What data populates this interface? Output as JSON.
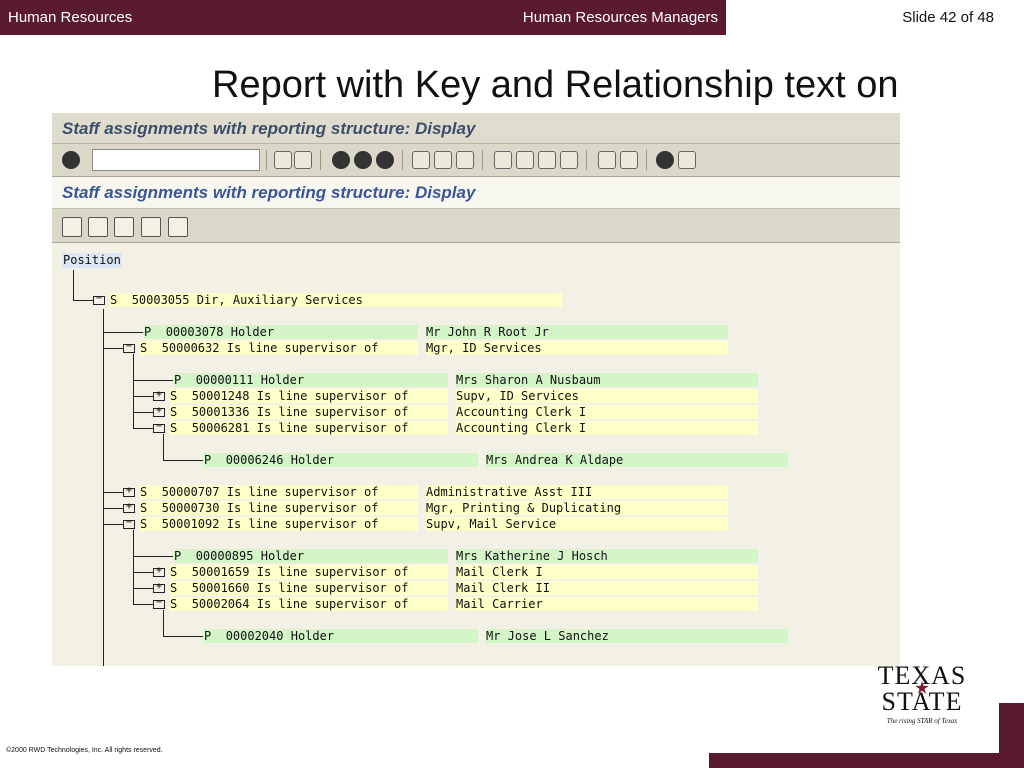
{
  "header": {
    "left": "Human Resources",
    "center": "Human Resources Managers",
    "slide": "Slide 42 of 48"
  },
  "slide_title": "Report with Key and Relationship text on",
  "sap": {
    "window_title": "Staff assignments with reporting structure: Display",
    "screen_title": "Staff assignments with reporting structure: Display",
    "command_value": "",
    "root_label": "Position"
  },
  "tree_rows": [
    {
      "type": "S",
      "id": "50003055",
      "rel": "Dir, Auxiliary Services",
      "target": ""
    },
    {
      "type": "P",
      "id": "00003078",
      "rel": "Holder",
      "target": "Mr John R Root Jr"
    },
    {
      "type": "S",
      "id": "50000632",
      "rel": "Is line supervisor of",
      "target": "Mgr, ID Services"
    },
    {
      "type": "P",
      "id": "00000111",
      "rel": "Holder",
      "target": "Mrs Sharon A Nusbaum"
    },
    {
      "type": "S",
      "id": "50001248",
      "rel": "Is line supervisor of",
      "target": "Supv, ID Services"
    },
    {
      "type": "S",
      "id": "50001336",
      "rel": "Is line supervisor of",
      "target": "Accounting Clerk I"
    },
    {
      "type": "S",
      "id": "50006281",
      "rel": "Is line supervisor of",
      "target": "Accounting Clerk I"
    },
    {
      "type": "P",
      "id": "00006246",
      "rel": "Holder",
      "target": "Mrs Andrea K Aldape"
    },
    {
      "type": "S",
      "id": "50000707",
      "rel": "Is line supervisor of",
      "target": "Administrative Asst III"
    },
    {
      "type": "S",
      "id": "50000730",
      "rel": "Is line supervisor of",
      "target": "Mgr, Printing & Duplicating"
    },
    {
      "type": "S",
      "id": "50001092",
      "rel": "Is line supervisor of",
      "target": "Supv, Mail Service"
    },
    {
      "type": "P",
      "id": "00000895",
      "rel": "Holder",
      "target": "Mrs Katherine J Hosch"
    },
    {
      "type": "S",
      "id": "50001659",
      "rel": "Is line supervisor of",
      "target": "Mail Clerk I"
    },
    {
      "type": "S",
      "id": "50001660",
      "rel": "Is line supervisor of",
      "target": "Mail Clerk II"
    },
    {
      "type": "S",
      "id": "50002064",
      "rel": "Is line supervisor of",
      "target": "Mail Carrier"
    },
    {
      "type": "P",
      "id": "00002040",
      "rel": "Holder",
      "target": "Mr Jose L Sanchez"
    }
  ],
  "footer": {
    "copyright": "©2000 RWD Technologies, Inc.  All rights reserved.",
    "logo_line1": "TEXAS",
    "logo_line2": "STATE",
    "logo_tagline": "The rising STAR of Texas"
  },
  "colors": {
    "maroon": "#5b1b2e",
    "tree_yellow": "#ffffc8",
    "tree_green": "#d4f5c8"
  }
}
